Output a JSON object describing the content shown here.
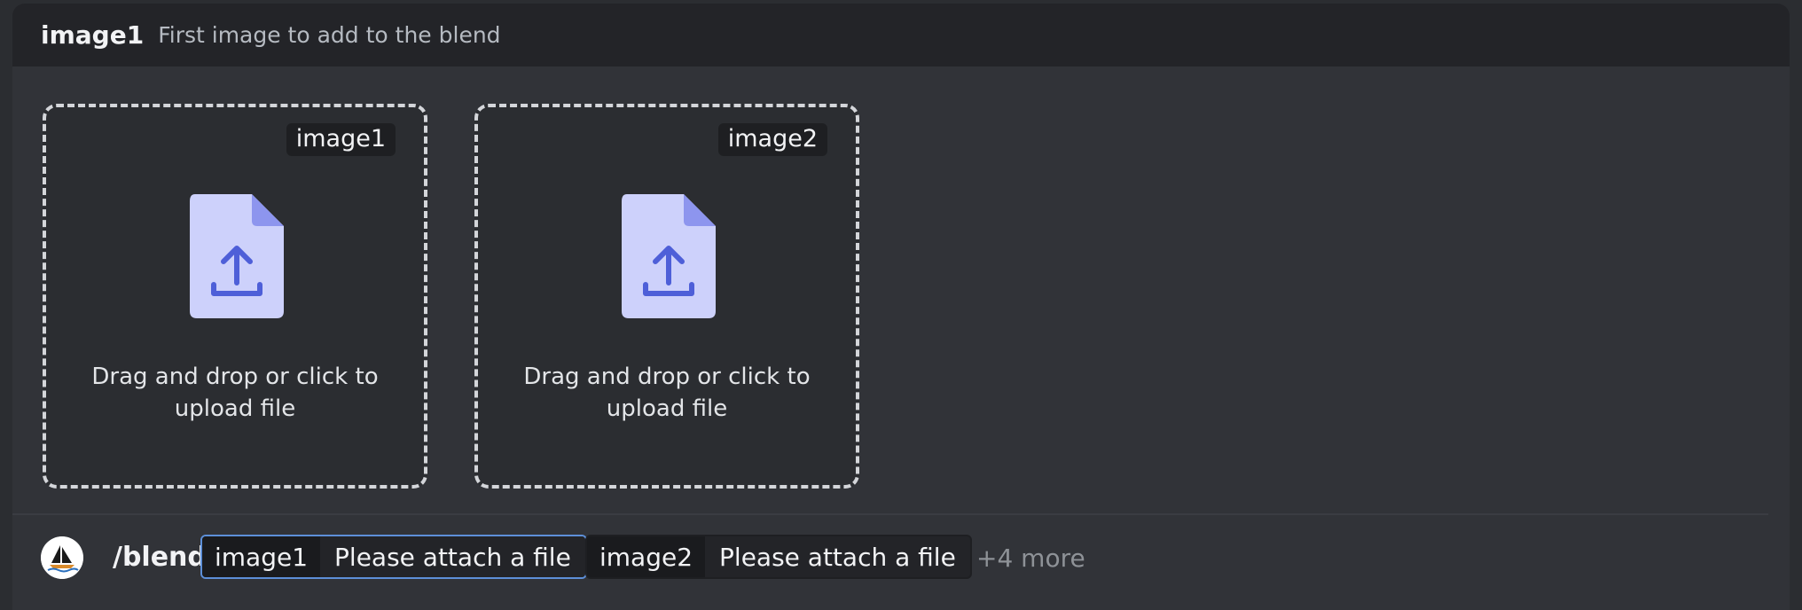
{
  "option": {
    "name": "image1",
    "description": "First image to add to the blend"
  },
  "drop_zones": [
    {
      "badge": "image1",
      "text_line1": "Drag and drop or click to",
      "text_line2": "upload file",
      "icon": "file-upload-icon"
    },
    {
      "badge": "image2",
      "text_line1": "Drag and drop or click to",
      "text_line2": "upload file",
      "icon": "file-upload-icon"
    }
  ],
  "command_bar": {
    "avatar_icon": "midjourney-boat-icon",
    "command": "/blend",
    "params": [
      {
        "key": "image1",
        "value": "Please attach a file",
        "active": true
      },
      {
        "key": "image2",
        "value": "Please attach a file",
        "active": false
      }
    ],
    "more": "+4 more"
  },
  "colors": {
    "background": "#313338",
    "header_bg": "#232428",
    "active_border": "#5d8fd8",
    "file_icon_fill": "#cdd1fb",
    "file_icon_fold": "#8d95ee",
    "file_icon_arrow": "#4e5fd8"
  }
}
